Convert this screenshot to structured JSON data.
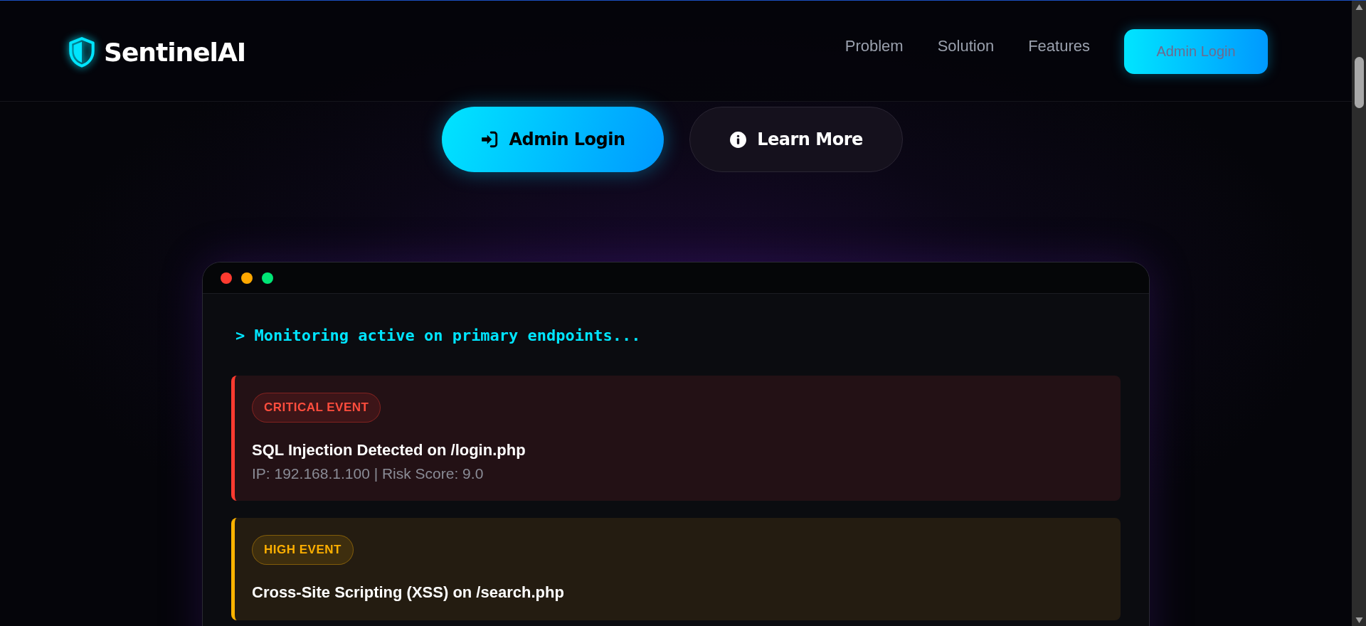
{
  "brand": {
    "name": "SentinelAI"
  },
  "nav": {
    "links": [
      {
        "label": "Problem"
      },
      {
        "label": "Solution"
      },
      {
        "label": "Features"
      }
    ],
    "cta": "Admin Login"
  },
  "hero_buttons": [
    {
      "kind": "primary",
      "label": "Admin Login"
    },
    {
      "kind": "secondary",
      "label": "Learn More"
    }
  ],
  "terminal": {
    "prompt": "> Monitoring active on primary endpoints...",
    "events": [
      {
        "kind": "critical",
        "badge": "CRITICAL EVENT",
        "title": "SQL Injection Detected on /login.php",
        "details": "IP: 192.168.1.100 | Risk Score: 9.0"
      },
      {
        "kind": "high",
        "badge": "HIGH EVENT",
        "title": "Cross-Site Scripting (XSS) on /search.php"
      }
    ]
  }
}
